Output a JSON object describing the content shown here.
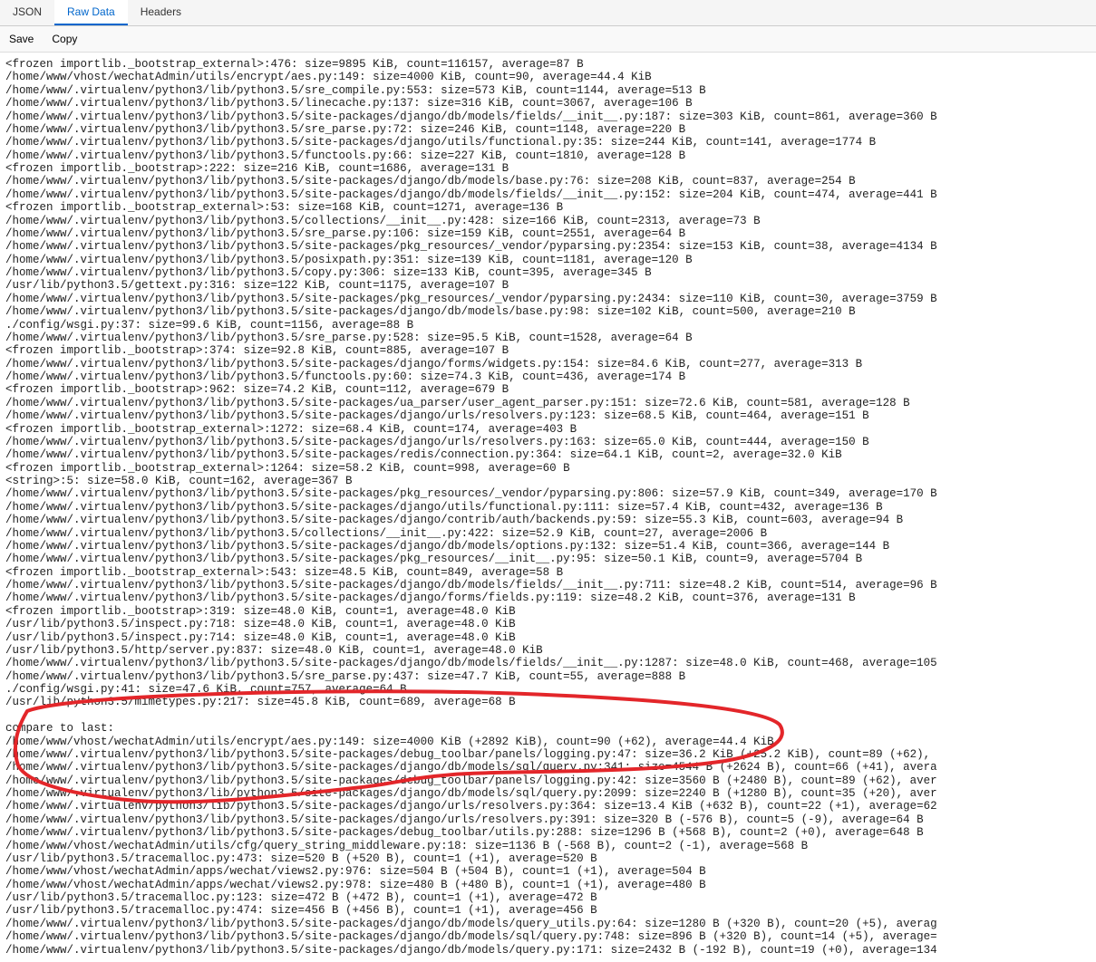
{
  "tabs": {
    "json": "JSON",
    "raw": "Raw Data",
    "headers": "Headers"
  },
  "actions": {
    "save": "Save",
    "copy": "Copy"
  },
  "lines": [
    "<frozen importlib._bootstrap_external>:476: size=9895 KiB, count=116157, average=87 B",
    "/home/www/vhost/wechatAdmin/utils/encrypt/aes.py:149: size=4000 KiB, count=90, average=44.4 KiB",
    "/home/www/.virtualenv/python3/lib/python3.5/sre_compile.py:553: size=573 KiB, count=1144, average=513 B",
    "/home/www/.virtualenv/python3/lib/python3.5/linecache.py:137: size=316 KiB, count=3067, average=106 B",
    "/home/www/.virtualenv/python3/lib/python3.5/site-packages/django/db/models/fields/__init__.py:187: size=303 KiB, count=861, average=360 B",
    "/home/www/.virtualenv/python3/lib/python3.5/sre_parse.py:72: size=246 KiB, count=1148, average=220 B",
    "/home/www/.virtualenv/python3/lib/python3.5/site-packages/django/utils/functional.py:35: size=244 KiB, count=141, average=1774 B",
    "/home/www/.virtualenv/python3/lib/python3.5/functools.py:66: size=227 KiB, count=1810, average=128 B",
    "<frozen importlib._bootstrap>:222: size=216 KiB, count=1686, average=131 B",
    "/home/www/.virtualenv/python3/lib/python3.5/site-packages/django/db/models/base.py:76: size=208 KiB, count=837, average=254 B",
    "/home/www/.virtualenv/python3/lib/python3.5/site-packages/django/db/models/fields/__init__.py:152: size=204 KiB, count=474, average=441 B",
    "<frozen importlib._bootstrap_external>:53: size=168 KiB, count=1271, average=136 B",
    "/home/www/.virtualenv/python3/lib/python3.5/collections/__init__.py:428: size=166 KiB, count=2313, average=73 B",
    "/home/www/.virtualenv/python3/lib/python3.5/sre_parse.py:106: size=159 KiB, count=2551, average=64 B",
    "/home/www/.virtualenv/python3/lib/python3.5/site-packages/pkg_resources/_vendor/pyparsing.py:2354: size=153 KiB, count=38, average=4134 B",
    "/home/www/.virtualenv/python3/lib/python3.5/posixpath.py:351: size=139 KiB, count=1181, average=120 B",
    "/home/www/.virtualenv/python3/lib/python3.5/copy.py:306: size=133 KiB, count=395, average=345 B",
    "/usr/lib/python3.5/gettext.py:316: size=122 KiB, count=1175, average=107 B",
    "/home/www/.virtualenv/python3/lib/python3.5/site-packages/pkg_resources/_vendor/pyparsing.py:2434: size=110 KiB, count=30, average=3759 B",
    "/home/www/.virtualenv/python3/lib/python3.5/site-packages/django/db/models/base.py:98: size=102 KiB, count=500, average=210 B",
    "./config/wsgi.py:37: size=99.6 KiB, count=1156, average=88 B",
    "/home/www/.virtualenv/python3/lib/python3.5/sre_parse.py:528: size=95.5 KiB, count=1528, average=64 B",
    "<frozen importlib._bootstrap>:374: size=92.8 KiB, count=885, average=107 B",
    "/home/www/.virtualenv/python3/lib/python3.5/site-packages/django/forms/widgets.py:154: size=84.6 KiB, count=277, average=313 B",
    "/home/www/.virtualenv/python3/lib/python3.5/functools.py:60: size=74.3 KiB, count=436, average=174 B",
    "<frozen importlib._bootstrap>:962: size=74.2 KiB, count=112, average=679 B",
    "/home/www/.virtualenv/python3/lib/python3.5/site-packages/ua_parser/user_agent_parser.py:151: size=72.6 KiB, count=581, average=128 B",
    "/home/www/.virtualenv/python3/lib/python3.5/site-packages/django/urls/resolvers.py:123: size=68.5 KiB, count=464, average=151 B",
    "<frozen importlib._bootstrap_external>:1272: size=68.4 KiB, count=174, average=403 B",
    "/home/www/.virtualenv/python3/lib/python3.5/site-packages/django/urls/resolvers.py:163: size=65.0 KiB, count=444, average=150 B",
    "/home/www/.virtualenv/python3/lib/python3.5/site-packages/redis/connection.py:364: size=64.1 KiB, count=2, average=32.0 KiB",
    "<frozen importlib._bootstrap_external>:1264: size=58.2 KiB, count=998, average=60 B",
    "<string>:5: size=58.0 KiB, count=162, average=367 B",
    "/home/www/.virtualenv/python3/lib/python3.5/site-packages/pkg_resources/_vendor/pyparsing.py:806: size=57.9 KiB, count=349, average=170 B",
    "/home/www/.virtualenv/python3/lib/python3.5/site-packages/django/utils/functional.py:111: size=57.4 KiB, count=432, average=136 B",
    "/home/www/.virtualenv/python3/lib/python3.5/site-packages/django/contrib/auth/backends.py:59: size=55.3 KiB, count=603, average=94 B",
    "/home/www/.virtualenv/python3/lib/python3.5/collections/__init__.py:422: size=52.9 KiB, count=27, average=2006 B",
    "/home/www/.virtualenv/python3/lib/python3.5/site-packages/django/db/models/options.py:132: size=51.4 KiB, count=366, average=144 B",
    "/home/www/.virtualenv/python3/lib/python3.5/site-packages/pkg_resources/__init__.py:95: size=50.1 KiB, count=9, average=5704 B",
    "<frozen importlib._bootstrap_external>:543: size=48.5 KiB, count=849, average=58 B",
    "/home/www/.virtualenv/python3/lib/python3.5/site-packages/django/db/models/fields/__init__.py:711: size=48.2 KiB, count=514, average=96 B",
    "/home/www/.virtualenv/python3/lib/python3.5/site-packages/django/forms/fields.py:119: size=48.2 KiB, count=376, average=131 B",
    "<frozen importlib._bootstrap>:319: size=48.0 KiB, count=1, average=48.0 KiB",
    "/usr/lib/python3.5/inspect.py:718: size=48.0 KiB, count=1, average=48.0 KiB",
    "/usr/lib/python3.5/inspect.py:714: size=48.0 KiB, count=1, average=48.0 KiB",
    "/usr/lib/python3.5/http/server.py:837: size=48.0 KiB, count=1, average=48.0 KiB",
    "/home/www/.virtualenv/python3/lib/python3.5/site-packages/django/db/models/fields/__init__.py:1287: size=48.0 KiB, count=468, average=105",
    "/home/www/.virtualenv/python3/lib/python3.5/sre_parse.py:437: size=47.7 KiB, count=55, average=888 B",
    "./config/wsgi.py:41: size=47.6 KiB, count=757, average=64 B",
    "/usr/lib/python3.5/mimetypes.py:217: size=45.8 KiB, count=689, average=68 B",
    "",
    "compare to last:",
    "/home/www/vhost/wechatAdmin/utils/encrypt/aes.py:149: size=4000 KiB (+2892 KiB), count=90 (+62), average=44.4 KiB",
    "/home/www/.virtualenv/python3/lib/python3.5/site-packages/debug_toolbar/panels/logging.py:47: size=36.2 KiB (+25.2 KiB), count=89 (+62),",
    "/home/www/.virtualenv/python3/lib/python3.5/site-packages/django/db/models/sql/query.py:341: size=4544 B (+2624 B), count=66 (+41), avera",
    "/home/www/.virtualenv/python3/lib/python3.5/site-packages/debug_toolbar/panels/logging.py:42: size=3560 B (+2480 B), count=89 (+62), aver",
    "/home/www/.virtualenv/python3/lib/python3.5/site-packages/django/db/models/sql/query.py:2099: size=2240 B (+1280 B), count=35 (+20), aver",
    "/home/www/.virtualenv/python3/lib/python3.5/site-packages/django/urls/resolvers.py:364: size=13.4 KiB (+632 B), count=22 (+1), average=62",
    "/home/www/.virtualenv/python3/lib/python3.5/site-packages/django/urls/resolvers.py:391: size=320 B (-576 B), count=5 (-9), average=64 B",
    "/home/www/.virtualenv/python3/lib/python3.5/site-packages/debug_toolbar/utils.py:288: size=1296 B (+568 B), count=2 (+0), average=648 B",
    "/home/www/vhost/wechatAdmin/utils/cfg/query_string_middleware.py:18: size=1136 B (-568 B), count=2 (-1), average=568 B",
    "/usr/lib/python3.5/tracemalloc.py:473: size=520 B (+520 B), count=1 (+1), average=520 B",
    "/home/www/vhost/wechatAdmin/apps/wechat/views2.py:976: size=504 B (+504 B), count=1 (+1), average=504 B",
    "/home/www/vhost/wechatAdmin/apps/wechat/views2.py:978: size=480 B (+480 B), count=1 (+1), average=480 B",
    "/usr/lib/python3.5/tracemalloc.py:123: size=472 B (+472 B), count=1 (+1), average=472 B",
    "/usr/lib/python3.5/tracemalloc.py:474: size=456 B (+456 B), count=1 (+1), average=456 B",
    "/home/www/.virtualenv/python3/lib/python3.5/site-packages/django/db/models/query_utils.py:64: size=1280 B (+320 B), count=20 (+5), averag",
    "/home/www/.virtualenv/python3/lib/python3.5/site-packages/django/db/models/sql/query.py:748: size=896 B (+320 B), count=14 (+5), average=",
    "/home/www/.virtualenv/python3/lib/python3.5/site-packages/django/db/models/query.py:171: size=2432 B (-192 B), count=19 (+0), average=134"
  ]
}
